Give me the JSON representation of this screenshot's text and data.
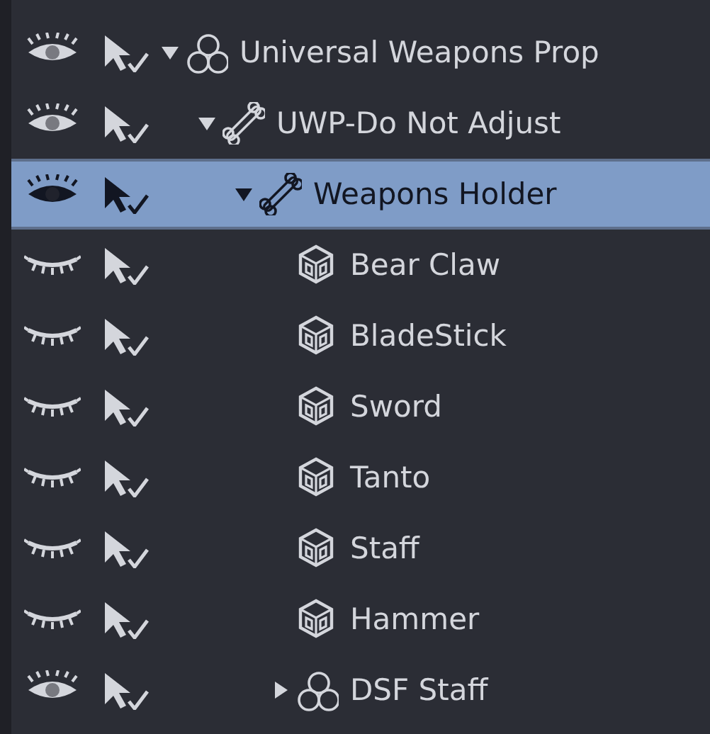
{
  "scene_tree": [
    {
      "label": "Universal Weapons Prop",
      "kind": "group",
      "visible": true,
      "expanded": true,
      "selected": false,
      "children": [
        {
          "label": "UWP-Do Not Adjust",
          "kind": "bone",
          "visible": true,
          "expanded": true,
          "selected": false,
          "children": [
            {
              "label": "Weapons Holder",
              "kind": "bone",
              "visible": true,
              "expanded": true,
              "selected": true,
              "children": [
                {
                  "label": "Bear Claw",
                  "kind": "prop",
                  "visible": false,
                  "selected": false
                },
                {
                  "label": "BladeStick",
                  "kind": "prop",
                  "visible": false,
                  "selected": false
                },
                {
                  "label": "Sword",
                  "kind": "prop",
                  "visible": false,
                  "selected": false
                },
                {
                  "label": "Tanto",
                  "kind": "prop",
                  "visible": false,
                  "selected": false
                },
                {
                  "label": "Staff",
                  "kind": "prop",
                  "visible": false,
                  "selected": false
                },
                {
                  "label": "Hammer",
                  "kind": "prop",
                  "visible": false,
                  "selected": false
                },
                {
                  "label": "DSF Staff",
                  "kind": "group",
                  "visible": true,
                  "expanded": false,
                  "selected": false
                }
              ]
            }
          ]
        }
      ]
    }
  ]
}
